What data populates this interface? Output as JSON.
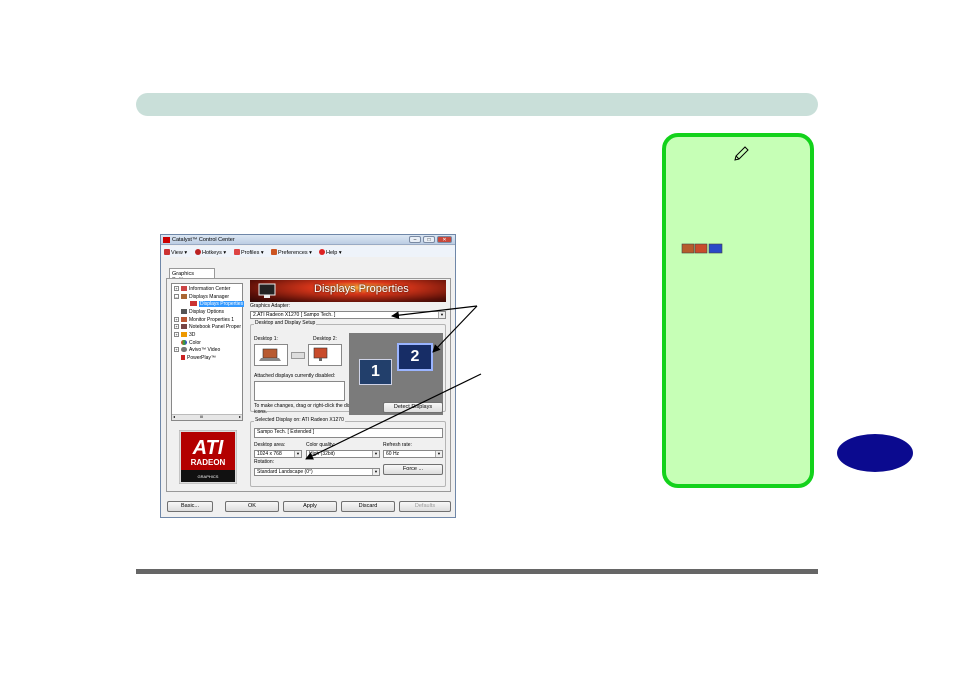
{
  "window": {
    "title": "Catalyst™ Control Center",
    "controls": {
      "minimize": "–",
      "maximize": "□",
      "close": "✕"
    }
  },
  "menu": {
    "items": [
      {
        "label": "View ▾",
        "icon": "view-icon"
      },
      {
        "label": "Hotkeys ▾",
        "icon": "hotkeys-icon"
      },
      {
        "label": "Profiles ▾",
        "icon": "profiles-icon"
      },
      {
        "label": "Preferences ▾",
        "icon": "preferences-icon"
      },
      {
        "label": "Help ▾",
        "icon": "help-icon"
      }
    ]
  },
  "tab": {
    "label": "Graphics Settings"
  },
  "tree": {
    "items": [
      {
        "label": "Information Center",
        "expander": "+",
        "indent": false,
        "selected": false
      },
      {
        "label": "Displays Manager",
        "expander": "–",
        "indent": false,
        "selected": false
      },
      {
        "label": "Displays Properties",
        "expander": "",
        "indent": true,
        "selected": true
      },
      {
        "label": "Display Options",
        "expander": "",
        "indent": false,
        "selected": false
      },
      {
        "label": "Monitor Properties 1",
        "expander": "+",
        "indent": false,
        "selected": false
      },
      {
        "label": "Notebook Panel Proper",
        "expander": "+",
        "indent": false,
        "selected": false
      },
      {
        "label": "3D",
        "expander": "+",
        "indent": false,
        "selected": false
      },
      {
        "label": "Color",
        "expander": "",
        "indent": false,
        "selected": false
      },
      {
        "label": "Avivo™ Video",
        "expander": "+",
        "indent": false,
        "selected": false
      },
      {
        "label": "PowerPlay™",
        "expander": "",
        "indent": false,
        "selected": false
      }
    ],
    "scroll_label": "III"
  },
  "logo": {
    "brand": "ATI",
    "line1": "RADEON",
    "line2": "GRAPHICS"
  },
  "displays": {
    "banner_title": "Displays Properties",
    "adapter_label": "Graphics Adapter:",
    "adapter_value": "2.ATI Radeon X1270 [ Sampo Tech. ]",
    "setup_label": "Desktop and Display Setup",
    "desktop1_label": "Desktop 1:",
    "desktop2_label": "Desktop 2:",
    "disabled_label": "Attached displays currently disabled:",
    "hint": "To make changes, drag or right-click the display icons.",
    "detect_button": "Detect Displays",
    "monitor1": "1",
    "monitor2": "2",
    "selected_label": "Selected Display on: ATI Radeon X1270",
    "selected_value": "Sampo Tech. [ Extended ]",
    "desktop_area_label": "Desktop area:",
    "desktop_area_value": "1024 x 768",
    "color_quality_label": "Color quality:",
    "color_quality_value": "High (32bit)",
    "refresh_label": "Refresh rate:",
    "refresh_value": "60 Hz",
    "rotation_label": "Rotation:",
    "rotation_value": "Standard Landscape (0°)",
    "force_button": "Force ..."
  },
  "bottom": {
    "basic": "Basic...",
    "ok": "OK",
    "apply": "Apply",
    "discard": "Discard",
    "defaults": "Defaults"
  },
  "colors": {
    "note_border": "#13d21b",
    "note_fill": "#c6ffb6",
    "chapter_tab": "#0b0a8f",
    "top_bar": "#c9dfd9",
    "selection": "#3399ff"
  }
}
